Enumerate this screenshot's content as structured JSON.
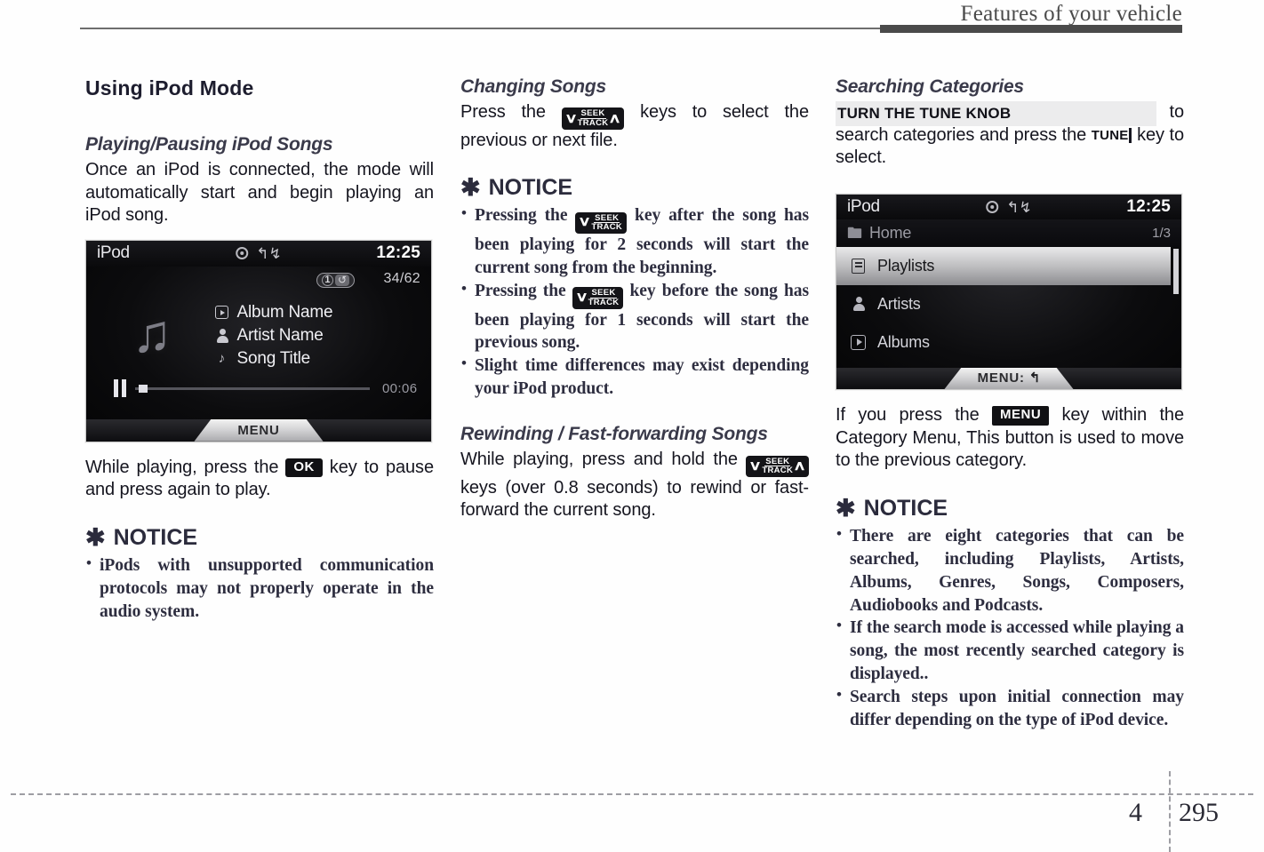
{
  "header": {
    "title": "Features of your vehicle"
  },
  "footer": {
    "chapter": "4",
    "page": "295"
  },
  "column1": {
    "section_title": "Using iPod Mode",
    "sub_title": "Playing/Pausing iPod Songs",
    "intro_text": "Once an iPod is connected, the mode will automatically start and begin playing an iPod song.",
    "player_screen": {
      "source": "iPod",
      "disc_icon": "disc-icon",
      "usb_icon": "usb-icon",
      "time": "12:25",
      "track_counter": "34/62",
      "repeat_badge_number": "1",
      "repeat_badge_icon": "repeat-icon",
      "album_art_icon": "music-note-icon",
      "rows": [
        {
          "icon": "album-icon",
          "label": "Album Name"
        },
        {
          "icon": "artist-icon",
          "label": "Artist Name"
        },
        {
          "icon": "song-icon",
          "label": "Song Title"
        }
      ],
      "transport_state_icon": "pause-icon",
      "elapsed": "00:06",
      "menu_tab_label": "MENU"
    },
    "after_shot_pre": "While playing, press the",
    "after_shot_key": "OK",
    "after_shot_post": "key to pause and press again to play.",
    "notice_heading": "NOTICE",
    "notice_star": "✱",
    "notice_items": [
      "iPods with unsupported communication protocols may not properly operate in the audio system."
    ]
  },
  "column2": {
    "sub_title_1": "Changing Songs",
    "changing_pre": "Press the",
    "changing_key": {
      "down": "∨",
      "up": "∧",
      "top": "SEEK",
      "bottom": "TRACK"
    },
    "changing_post": "keys to select the previous or next file.",
    "notice_heading": "NOTICE",
    "notice_star": "✱",
    "notice_items": [
      {
        "pre": "Pressing the",
        "post": "key after the song has been playing for 2 seconds will start the current song from the beginning.",
        "key_has_up": false
      },
      {
        "pre": "Pressing the",
        "post": "key before the song has been playing for 1 seconds will start the previous song.",
        "key_has_up": false
      },
      {
        "pre": "",
        "post": "Slight time differences may exist depending your iPod product.",
        "key_has_up": null
      }
    ],
    "sub_title_2": "Rewinding / Fast-forwarding Songs",
    "rewind_pre": "While playing, press and hold the",
    "rewind_post": "keys (over 0.8 seconds) to rewind or fast-forward the current song."
  },
  "column3": {
    "sub_title": "Searching Categories",
    "overlay_text": "TURN THE TUNE KNOB",
    "search_mid": "to search categories and press the",
    "tune_token": "TUNE",
    "search_end": "key to select.",
    "category_screen": {
      "source": "iPod",
      "disc_icon": "disc-icon",
      "usb_icon": "usb-icon",
      "time": "12:25",
      "breadcrumb_icon": "folder-icon",
      "breadcrumb": "Home",
      "page_indicator": "1/3",
      "items": [
        {
          "icon": "playlist-icon",
          "label": "Playlists",
          "selected": true
        },
        {
          "icon": "artist-icon",
          "label": "Artists",
          "selected": false
        },
        {
          "icon": "album-icon",
          "label": "Albums",
          "selected": false
        }
      ],
      "menu_tab_label": "MENU:",
      "menu_tab_arrow": "↰"
    },
    "menu_pre": "If you press the",
    "menu_key": "MENU",
    "menu_post": "key within the Category Menu, This button is used to move to the previous category.",
    "notice_heading": "NOTICE",
    "notice_star": "✱",
    "notice_items": [
      "There are eight categories that can be searched, including Playlists, Artists, Albums, Genres, Songs, Composers, Audiobooks and Podcasts.",
      "If the search mode is accessed while playing a song, the most recently searched category is displayed..",
      "Search steps upon initial connection may differ depending on the type of iPod device."
    ]
  }
}
